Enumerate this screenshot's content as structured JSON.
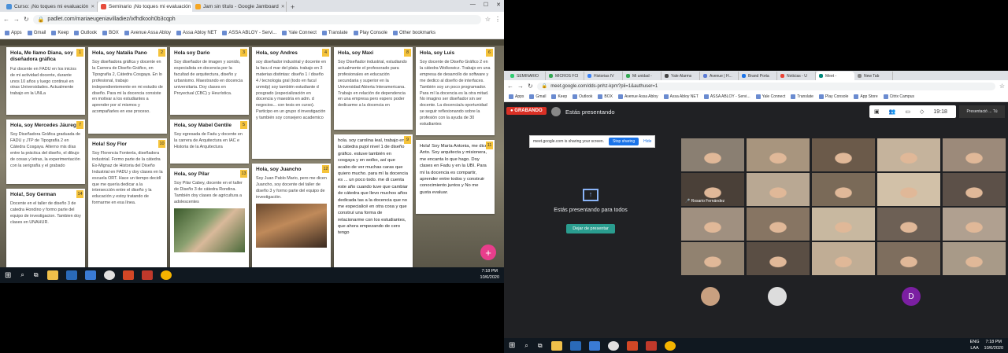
{
  "left": {
    "tabs": [
      {
        "label": "Curso: ¡No toques mi evaluación",
        "color": "#4a90d9"
      },
      {
        "label": "Seminario ¡No toques mi evaluación",
        "color": "#e74c3c"
      },
      {
        "label": "Jam sin título - Google Jamboard",
        "color": "#f5a623"
      }
    ],
    "url": "padlet.com/mariaeugeniavilladiez/ixfhdkooh0b3cqph",
    "bookmarks": [
      "Apps",
      "Gmail",
      "Keep",
      "Outlook",
      "BOX",
      "Avenue Assa Abloy",
      "Assa Abloy NET",
      "ASSA ABLOY - Servi...",
      "Yale Connect",
      "Translate",
      "Play Console",
      "Other bookmarks"
    ],
    "cards": [
      {
        "num": "1",
        "title": "Hola, Me llamo Diana, soy diseñadora gráfica",
        "body": "Fui docente en FADU en los inicios de mi actividad docente, durante unos 10 años y luego continué en otras Universidades. Actualmente trabajo en la UNLa"
      },
      {
        "num": "7",
        "title": "Hola, soy Mercedes Jáuregui",
        "body": "Soy Diseñadora Gráfica graduada de FADU y JTP de Tipografía 2 en Cátedra Cosgaya. Alterno mis días entre la práctica del diseño, el dibujo de cosas y letras, la experimentación con la serigrafía y el grabado"
      },
      {
        "num": "14",
        "title": "Hola!, Soy German",
        "body": "Docente en el taller de diseño 3 de catedra Hondino y formo parte del equipo de investigacion. Tambien doy clases en UNAHUR."
      },
      {
        "num": "2",
        "title": "Hola, soy Natalia Pano",
        "body": "Soy diseñadora gráfica y docente en la Carrera de Diseño Gráfico, en Tipografía 2, Cátedra Cosgaya. En lo profesional, trabajo independientemente en mi estudio de diseño. Para mi la docencia consiste en motivar a los estudiantes a aprender por sí mismos y acompañarles en ese proceso."
      },
      {
        "num": "10",
        "title": "Hola! Soy Flor",
        "body": "Soy Florencia Fontenla, diseñadora industrial. Formo parte de la cátedra Ex-Mignaz de Historia del Diseño Industrial en FADU y doy clases en la escuela ORT. Hace un tiempo decidí que me quería dedicar a la intersección entre el diseño y la educación y estoy tratando de formarme en esa línea."
      },
      {
        "num": "3",
        "title": "Hola soy Dario",
        "body": "Soy diseñador de imagen y sonido, especialista en docencia por la facultad de arquitectura, diseño y urbanismo. Maestrando en docencia universitaria. Doy clases en Proyectual (CBC) y Heurística."
      },
      {
        "num": "5",
        "title": "Hola, soy Mabel Gentile",
        "body": "Soy egresada de Fadu y docente en la carrera de Arquitectura en IAC e Historia de la Arquitectura"
      },
      {
        "num": "13",
        "title": "Hola, soy Pilar",
        "body": "Soy Pilar Cabey, docente en el taller de Diseño 3 de cátedra Rondina. También doy clases de agricultura a adolescentes"
      },
      {
        "num": "4",
        "title": "Hola, soy Andres",
        "body": "soy diseñador industrial y docente en la facu d mar del plata. trabajo en 3 materias distintas: diseño 1 / diseño 4 / tecnologia gral (todo en facul unmdp) soy también estudiante d posgrado (especialización en docencia y maestría en adm. d negocios... con tesis en curso). Participo en un grupo d investigación y también soy consejero academico"
      },
      {
        "num": "12",
        "title": "Hola, soy Juancho",
        "body": "Soy Juan Pablo Mario, pero me dicen Juancho, soy docente del taller de diseño 3 y formo parte del equipo de investigación."
      },
      {
        "num": "8",
        "title": "Hola, soy Maxi",
        "body": "Soy Diseñador industrial, estudiando actualmente el profesorado para profesionales en educación secundaria y superior en la Universidad Abierta Interamericana. Trabajo en relación de dependencia en una empresa pero espero poder dedicarme a la docencia en"
      },
      {
        "num": "9",
        "title": "",
        "body": "hola. soy carolina leal, trabajo en la cátedra pujol nivel 1 de diseño gráfico. estuve también en cosgaya y en wolko, así que acabo de ver muchas caras que quiero mucho. para mí la docencia es ... un poco todo. me di cuenta este año cuando tuve que cambiar de cátedra que llevo muchos años dedicada tas a la docencia que no me especialicé en otra cosa y que construí una forma de relacionarme con los estudiantes, que ahora empezando de cero tengo"
      },
      {
        "num": "6",
        "title": "Hola, soy Luis",
        "body": "Soy docente de Diseño Gráfico 2 en la cátedra Wolkowicz. Trabajo en una empresa de desarrollo de software y me dedico al diseño de interfaces. También soy un poco programador. Para mí la docencia es la otra mitad. No imagino ser diseñador sin ser docente. La docencia/a oportunidad se seguir reflexionando sobre la profesión con la ayuda de 30 estudiantes"
      },
      {
        "num": "11",
        "title": "",
        "body": "Hola! Soy María Antonia, me dicen Anto. Soy arquitecta y misionera, me encanta lo que hago. Doy clases en Fadu y en la UBI. Para mí la docencia es compartir, aprender entre todos y construir conocimiento juntos y No me gusta evaluar."
      }
    ],
    "fab": "+",
    "clock": {
      "time": "7:18 PM",
      "date": "10/6/2020"
    }
  },
  "right": {
    "tabs": [
      "SEMINARIO",
      "MICROS FCI",
      "Historias IV",
      "Mi unidad -",
      "Yale Alarms",
      "Avenue | H...",
      "Brand Porta",
      "Noticias - U",
      "Meet -",
      "New Tab"
    ],
    "url": "meet.google.com/dds-pnhz-kpm?pli=1&authuser=1",
    "bookmarks": [
      "Apps",
      "Gmail",
      "Keep",
      "Outlook",
      "BOX",
      "Avenue Assa Abloy",
      "Assa Abloy NET",
      "ASSA ABLOY - Servi...",
      "Yale Connect",
      "Translate",
      "Play Console",
      "App Store",
      "Citrix Campus"
    ],
    "recording": "GRABANDO",
    "presenting": "Estás presentando",
    "meet_time": "19:18",
    "presenter_label": "Presentació ... Tú",
    "share_bar": {
      "text": "meet.google.com is sharing your screen.",
      "stop": "Stop sharing",
      "hide": "Hide"
    },
    "present_title": "Estás presentando para todos",
    "stop_btn": "Dejar de presentar",
    "speaker_name": "Rosario Fernández",
    "avatar_letter": "D",
    "clock": {
      "time": "7:18 PM",
      "date": "10/6/2020",
      "lang": "ENG",
      "region": "LAA"
    }
  }
}
